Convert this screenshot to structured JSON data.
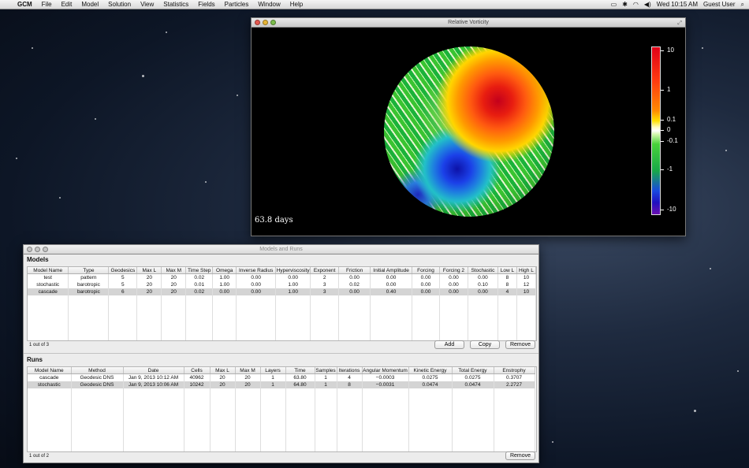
{
  "menubar": {
    "app_name": "GCM",
    "items": [
      "File",
      "Edit",
      "Model",
      "Solution",
      "View",
      "Statistics",
      "Fields",
      "Particles",
      "Window",
      "Help"
    ],
    "clock": "Wed 10:15 AM",
    "user": "Guest User"
  },
  "vorticity_window": {
    "title": "Relative Vorticity",
    "elapsed": "63.8 days",
    "colorbar_labels": [
      "10",
      "1",
      "0.1",
      "0",
      "-0.1",
      "-1",
      "-10"
    ]
  },
  "models_window": {
    "title": "Models and Runs",
    "models": {
      "section_title": "Models",
      "columns": [
        "Model Name",
        "Type",
        "Geodesics",
        "Max L",
        "Max M",
        "Time Step",
        "Omega",
        "Inverse Radius",
        "Hyperviscosity",
        "Exponent",
        "Friction",
        "Initial Amplitude",
        "Forcing",
        "Forcing 2",
        "Stochastic",
        "Low L",
        "High L"
      ],
      "rows": [
        [
          "test",
          "pattern",
          "5",
          "20",
          "20",
          "0.02",
          "1.00",
          "0.00",
          "0.00",
          "2",
          "0.00",
          "0.00",
          "0.00",
          "0.00",
          "0.00",
          "8",
          "10"
        ],
        [
          "stochastic",
          "barotropic",
          "5",
          "20",
          "20",
          "0.01",
          "1.00",
          "0.00",
          "1.00",
          "3",
          "0.02",
          "0.00",
          "0.00",
          "0.00",
          "0.10",
          "8",
          "12"
        ],
        [
          "cascade",
          "barotropic",
          "6",
          "20",
          "20",
          "0.02",
          "0.00",
          "0.00",
          "1.00",
          "3",
          "0.00",
          "0.40",
          "0.00",
          "0.00",
          "0.00",
          "4",
          "10"
        ]
      ],
      "count": "1 out of 3",
      "add_label": "Add",
      "copy_label": "Copy",
      "remove_label": "Remove"
    },
    "runs": {
      "section_title": "Runs",
      "columns": [
        "Model Name",
        "Method",
        "Date",
        "Cells",
        "Max L",
        "Max M",
        "Layers",
        "Time",
        "Samples",
        "Iterations",
        "Angular Momentum",
        "Kinetic Energy",
        "Total Energy",
        "Enstrophy"
      ],
      "rows": [
        [
          "cascade",
          "Geodesic DNS",
          "Jan 9, 2013 10:12 AM",
          "40962",
          "20",
          "20",
          "1",
          "63.80",
          "1",
          "4",
          "−0.0003",
          "0.0275",
          "0.0275",
          "0.3707"
        ],
        [
          "stochastic",
          "Geodesic DNS",
          "Jan 9, 2013 10:06 AM",
          "10242",
          "20",
          "20",
          "1",
          "64.80",
          "1",
          "8",
          "−0.0031",
          "0.0474",
          "0.0474",
          "2.2727"
        ]
      ],
      "count": "1 out of 2",
      "remove_label": "Remove"
    }
  }
}
